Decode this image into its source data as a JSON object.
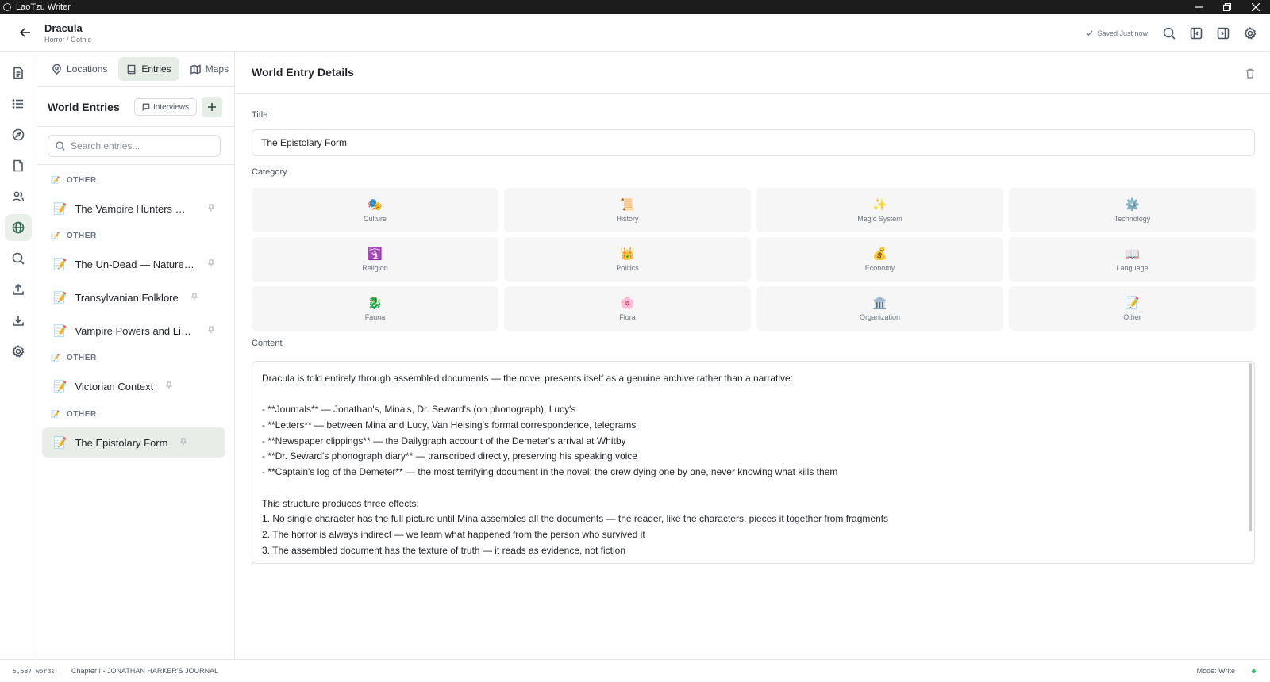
{
  "window": {
    "app_name": "LaoTzu Writer"
  },
  "header": {
    "title": "Dracula",
    "subtitle": "Horror / Gothic",
    "saved_status": "Saved Just now"
  },
  "sidebar": {
    "tabs": [
      {
        "label": "Locations",
        "icon": "map-pin-icon"
      },
      {
        "label": "Entries",
        "icon": "book-icon",
        "active": true
      },
      {
        "label": "Maps",
        "icon": "map-icon"
      }
    ],
    "title": "World Entries",
    "interviews_label": "Interviews",
    "search_placeholder": "Search entries...",
    "groups": [
      {
        "label": "OTHER",
        "entries": [
          "The Vampire Hunters — The Crew of Light"
        ]
      },
      {
        "label": "OTHER",
        "entries": [
          "The Un-Dead — Nature and Rules",
          "Transylvanian Folklore",
          "Vampire Powers and Limitations"
        ]
      },
      {
        "label": "OTHER",
        "entries": [
          "Victorian Context"
        ]
      },
      {
        "label": "OTHER",
        "entries": [
          "The Epistolary Form"
        ]
      }
    ],
    "active_entry": "The Epistolary Form"
  },
  "main": {
    "heading": "World Entry Details",
    "title_label": "Title",
    "title_value": "The Epistolary Form",
    "category_label": "Category",
    "categories": [
      {
        "emoji": "🎭",
        "label": "Culture"
      },
      {
        "emoji": "📜",
        "label": "History"
      },
      {
        "emoji": "✨",
        "label": "Magic System"
      },
      {
        "emoji": "⚙️",
        "label": "Technology"
      },
      {
        "emoji": "🛐",
        "label": "Religion"
      },
      {
        "emoji": "👑",
        "label": "Politics"
      },
      {
        "emoji": "💰",
        "label": "Economy"
      },
      {
        "emoji": "📖",
        "label": "Language"
      },
      {
        "emoji": "🐉",
        "label": "Fauna"
      },
      {
        "emoji": "🌸",
        "label": "Flora"
      },
      {
        "emoji": "🏛️",
        "label": "Organization"
      },
      {
        "emoji": "📝",
        "label": "Other"
      }
    ],
    "content_label": "Content",
    "content_lines": [
      "Dracula is told entirely through assembled documents — the novel presents itself as a genuine archive rather than a narrative:",
      "",
      "- **Journals** — Jonathan's, Mina's, Dr. Seward's (on phonograph), Lucy's",
      "- **Letters** — between Mina and Lucy, Van Helsing's formal correspondence, telegrams",
      "- **Newspaper clippings** — the Dailygraph account of the Demeter's arrival at Whitby",
      "- **Dr. Seward's phonograph diary** — transcribed directly, preserving his speaking voice",
      "- **Captain's log of the Demeter** — the most terrifying document in the novel; the crew dying one by one, never knowing what kills them",
      "",
      "This structure produces three effects:",
      "1. No single character has the full picture until Mina assembles all the documents — the reader, like the characters, pieces it together from fragments",
      "2. The horror is always indirect — we learn what happened from the person who survived it",
      "3. The assembled document has the texture of truth — it reads as evidence, not fiction"
    ]
  },
  "status_bar": {
    "word_count": "5,687 words",
    "chapter": "Chapter I - JONATHAN HARKER'S JOURNAL",
    "mode": "Mode: Write",
    "status_color": "#22c55e"
  }
}
